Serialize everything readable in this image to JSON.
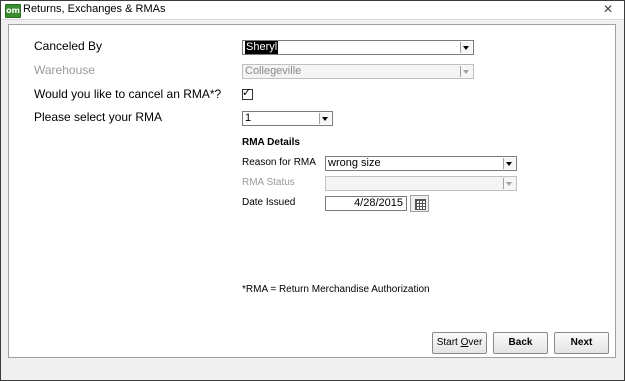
{
  "window": {
    "title": "Returns, Exchanges & RMAs",
    "app_icon_text": "om"
  },
  "form": {
    "canceled_by": {
      "label": "Canceled By",
      "value": "Sheryl"
    },
    "warehouse": {
      "label": "Warehouse",
      "value": "Collegeville"
    },
    "cancel_rma": {
      "label": "Would you like to cancel an RMA*?",
      "checked": true
    },
    "select_rma": {
      "label": "Please select your RMA",
      "value": "1"
    }
  },
  "rma_details": {
    "heading": "RMA Details",
    "reason": {
      "label": "Reason for RMA",
      "value": "wrong size"
    },
    "status": {
      "label": "RMA Status",
      "value": ""
    },
    "date_issued": {
      "label": "Date Issued",
      "value": "4/28/2015"
    }
  },
  "footnote": "*RMA = Return Merchandise Authorization",
  "buttons": {
    "start_over_prefix": "Start ",
    "start_over_accel": "O",
    "start_over_suffix": "ver",
    "back": "Back",
    "next": "Next"
  },
  "icons": {
    "close": "close-icon",
    "calendar": "calendar-icon",
    "checkmark": "checkmark-icon",
    "dropdown": "chevron-down-icon"
  }
}
